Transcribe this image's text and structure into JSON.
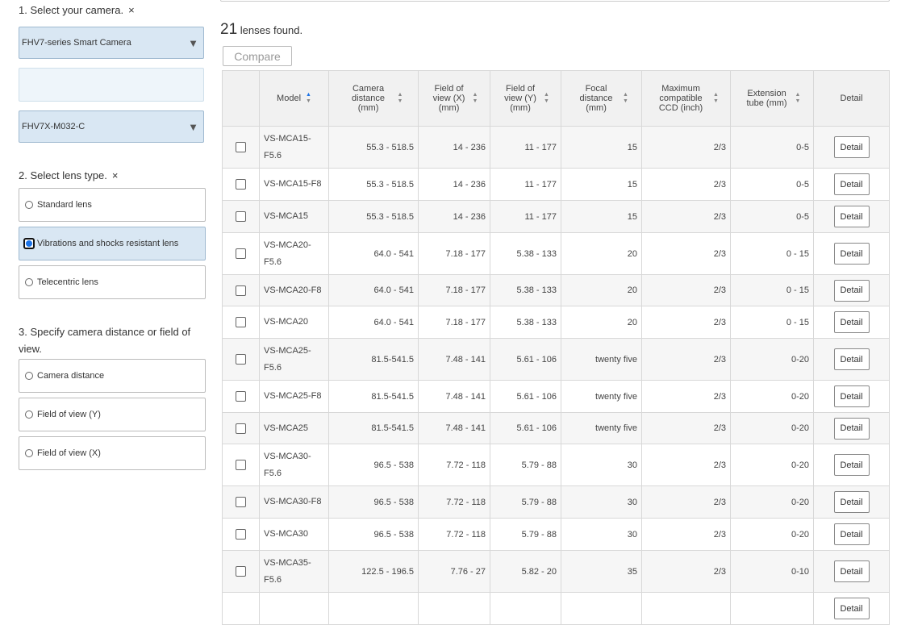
{
  "sidebar": {
    "step1_title": "1. Select your camera.",
    "clear_x": "×",
    "camera_select": "FHV7-series Smart Camera",
    "blank_select": "",
    "model_select": "FHV7X-M032-C",
    "step2_title": "2. Select lens type.",
    "lens_types": [
      {
        "label": "Standard lens",
        "selected": false
      },
      {
        "label": "Vibrations and shocks resistant lens",
        "selected": true
      },
      {
        "label": "Telecentric lens",
        "selected": false
      }
    ],
    "step3_title": "3. Specify camera distance or field of view.",
    "spec_options": [
      {
        "label": "Camera distance"
      },
      {
        "label": "Field of view (Y)"
      },
      {
        "label": "Field of view (X)"
      }
    ],
    "arrow_icon": "▼"
  },
  "results": {
    "count": "21",
    "count_suffix": "lenses found.",
    "compare_label": "Compare"
  },
  "table": {
    "headers": [
      "Model",
      "Camera distance (mm)",
      "Field of view (X) (mm)",
      "Field of view (Y) (mm)",
      "Focal distance (mm)",
      "Maximum compatible CCD (inch)",
      "Extension tube (mm)",
      "Detail"
    ],
    "rows": [
      {
        "model": "VS-MCA15-F5.6",
        "cam": "55.3 - 518.5",
        "fovx": "14 - 236",
        "fovy": "11 - 177",
        "focal": "15",
        "ccd": "2/3",
        "tube": "0-5",
        "detail": "Detail"
      },
      {
        "model": "VS-MCA15-F8",
        "cam": "55.3 - 518.5",
        "fovx": "14 - 236",
        "fovy": "11 - 177",
        "focal": "15",
        "ccd": "2/3",
        "tube": "0-5",
        "detail": "Detail"
      },
      {
        "model": "VS-MCA15",
        "cam": "55.3 - 518.5",
        "fovx": "14 - 236",
        "fovy": "11 - 177",
        "focal": "15",
        "ccd": "2/3",
        "tube": "0-5",
        "detail": "Detail"
      },
      {
        "model": "VS-MCA20-F5.6",
        "cam": "64.0 - 541",
        "fovx": "7.18 - 177",
        "fovy": "5.38 - 133",
        "focal": "20",
        "ccd": "2/3",
        "tube": "0 - 15",
        "detail": "Detail"
      },
      {
        "model": "VS-MCA20-F8",
        "cam": "64.0 - 541",
        "fovx": "7.18 - 177",
        "fovy": "5.38 - 133",
        "focal": "20",
        "ccd": "2/3",
        "tube": "0 - 15",
        "detail": "Detail"
      },
      {
        "model": "VS-MCA20",
        "cam": "64.0 - 541",
        "fovx": "7.18 - 177",
        "fovy": "5.38 - 133",
        "focal": "20",
        "ccd": "2/3",
        "tube": "0 - 15",
        "detail": "Detail"
      },
      {
        "model": "VS-MCA25-F5.6",
        "cam": "81.5-541.5",
        "fovx": "7.48 - 141",
        "fovy": "5.61 - 106",
        "focal": "twenty five",
        "ccd": "2/3",
        "tube": "0-20",
        "detail": "Detail"
      },
      {
        "model": "VS-MCA25-F8",
        "cam": "81.5-541.5",
        "fovx": "7.48 - 141",
        "fovy": "5.61 - 106",
        "focal": "twenty five",
        "ccd": "2/3",
        "tube": "0-20",
        "detail": "Detail"
      },
      {
        "model": "VS-MCA25",
        "cam": "81.5-541.5",
        "fovx": "7.48 - 141",
        "fovy": "5.61 - 106",
        "focal": "twenty five",
        "ccd": "2/3",
        "tube": "0-20",
        "detail": "Detail"
      },
      {
        "model": "VS-MCA30-F5.6",
        "cam": "96.5 - 538",
        "fovx": "7.72 - 118",
        "fovy": "5.79 - 88",
        "focal": "30",
        "ccd": "2/3",
        "tube": "0-20",
        "detail": "Detail"
      },
      {
        "model": "VS-MCA30-F8",
        "cam": "96.5 - 538",
        "fovx": "7.72 - 118",
        "fovy": "5.79 - 88",
        "focal": "30",
        "ccd": "2/3",
        "tube": "0-20",
        "detail": "Detail"
      },
      {
        "model": "VS-MCA30",
        "cam": "96.5 - 538",
        "fovx": "7.72 - 118",
        "fovy": "5.79 - 88",
        "focal": "30",
        "ccd": "2/3",
        "tube": "0-20",
        "detail": "Detail"
      },
      {
        "model": "VS-MCA35-F5.6",
        "cam": "122.5 - 196.5",
        "fovx": "7.76 - 27",
        "fovy": "5.82 - 20",
        "focal": "35",
        "ccd": "2/3",
        "tube": "0-10",
        "detail": "Detail"
      },
      {
        "model": "",
        "cam": "",
        "fovx": "",
        "fovy": "",
        "focal": "",
        "ccd": "",
        "tube": "",
        "detail": "Detail"
      }
    ]
  }
}
